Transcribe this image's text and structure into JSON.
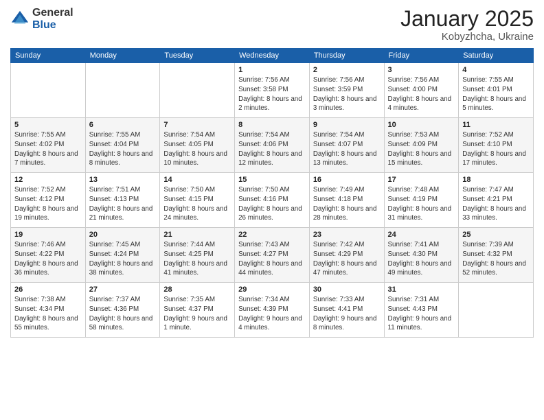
{
  "logo": {
    "general": "General",
    "blue": "Blue"
  },
  "title": {
    "month": "January 2025",
    "location": "Kobyzhcha, Ukraine"
  },
  "days_of_week": [
    "Sunday",
    "Monday",
    "Tuesday",
    "Wednesday",
    "Thursday",
    "Friday",
    "Saturday"
  ],
  "weeks": [
    [
      {
        "day": "",
        "info": ""
      },
      {
        "day": "",
        "info": ""
      },
      {
        "day": "",
        "info": ""
      },
      {
        "day": "1",
        "info": "Sunrise: 7:56 AM\nSunset: 3:58 PM\nDaylight: 8 hours\nand 2 minutes."
      },
      {
        "day": "2",
        "info": "Sunrise: 7:56 AM\nSunset: 3:59 PM\nDaylight: 8 hours\nand 3 minutes."
      },
      {
        "day": "3",
        "info": "Sunrise: 7:56 AM\nSunset: 4:00 PM\nDaylight: 8 hours\nand 4 minutes."
      },
      {
        "day": "4",
        "info": "Sunrise: 7:55 AM\nSunset: 4:01 PM\nDaylight: 8 hours\nand 5 minutes."
      }
    ],
    [
      {
        "day": "5",
        "info": "Sunrise: 7:55 AM\nSunset: 4:02 PM\nDaylight: 8 hours\nand 7 minutes."
      },
      {
        "day": "6",
        "info": "Sunrise: 7:55 AM\nSunset: 4:04 PM\nDaylight: 8 hours\nand 8 minutes."
      },
      {
        "day": "7",
        "info": "Sunrise: 7:54 AM\nSunset: 4:05 PM\nDaylight: 8 hours\nand 10 minutes."
      },
      {
        "day": "8",
        "info": "Sunrise: 7:54 AM\nSunset: 4:06 PM\nDaylight: 8 hours\nand 12 minutes."
      },
      {
        "day": "9",
        "info": "Sunrise: 7:54 AM\nSunset: 4:07 PM\nDaylight: 8 hours\nand 13 minutes."
      },
      {
        "day": "10",
        "info": "Sunrise: 7:53 AM\nSunset: 4:09 PM\nDaylight: 8 hours\nand 15 minutes."
      },
      {
        "day": "11",
        "info": "Sunrise: 7:52 AM\nSunset: 4:10 PM\nDaylight: 8 hours\nand 17 minutes."
      }
    ],
    [
      {
        "day": "12",
        "info": "Sunrise: 7:52 AM\nSunset: 4:12 PM\nDaylight: 8 hours\nand 19 minutes."
      },
      {
        "day": "13",
        "info": "Sunrise: 7:51 AM\nSunset: 4:13 PM\nDaylight: 8 hours\nand 21 minutes."
      },
      {
        "day": "14",
        "info": "Sunrise: 7:50 AM\nSunset: 4:15 PM\nDaylight: 8 hours\nand 24 minutes."
      },
      {
        "day": "15",
        "info": "Sunrise: 7:50 AM\nSunset: 4:16 PM\nDaylight: 8 hours\nand 26 minutes."
      },
      {
        "day": "16",
        "info": "Sunrise: 7:49 AM\nSunset: 4:18 PM\nDaylight: 8 hours\nand 28 minutes."
      },
      {
        "day": "17",
        "info": "Sunrise: 7:48 AM\nSunset: 4:19 PM\nDaylight: 8 hours\nand 31 minutes."
      },
      {
        "day": "18",
        "info": "Sunrise: 7:47 AM\nSunset: 4:21 PM\nDaylight: 8 hours\nand 33 minutes."
      }
    ],
    [
      {
        "day": "19",
        "info": "Sunrise: 7:46 AM\nSunset: 4:22 PM\nDaylight: 8 hours\nand 36 minutes."
      },
      {
        "day": "20",
        "info": "Sunrise: 7:45 AM\nSunset: 4:24 PM\nDaylight: 8 hours\nand 38 minutes."
      },
      {
        "day": "21",
        "info": "Sunrise: 7:44 AM\nSunset: 4:25 PM\nDaylight: 8 hours\nand 41 minutes."
      },
      {
        "day": "22",
        "info": "Sunrise: 7:43 AM\nSunset: 4:27 PM\nDaylight: 8 hours\nand 44 minutes."
      },
      {
        "day": "23",
        "info": "Sunrise: 7:42 AM\nSunset: 4:29 PM\nDaylight: 8 hours\nand 47 minutes."
      },
      {
        "day": "24",
        "info": "Sunrise: 7:41 AM\nSunset: 4:30 PM\nDaylight: 8 hours\nand 49 minutes."
      },
      {
        "day": "25",
        "info": "Sunrise: 7:39 AM\nSunset: 4:32 PM\nDaylight: 8 hours\nand 52 minutes."
      }
    ],
    [
      {
        "day": "26",
        "info": "Sunrise: 7:38 AM\nSunset: 4:34 PM\nDaylight: 8 hours\nand 55 minutes."
      },
      {
        "day": "27",
        "info": "Sunrise: 7:37 AM\nSunset: 4:36 PM\nDaylight: 8 hours\nand 58 minutes."
      },
      {
        "day": "28",
        "info": "Sunrise: 7:35 AM\nSunset: 4:37 PM\nDaylight: 9 hours\nand 1 minute."
      },
      {
        "day": "29",
        "info": "Sunrise: 7:34 AM\nSunset: 4:39 PM\nDaylight: 9 hours\nand 4 minutes."
      },
      {
        "day": "30",
        "info": "Sunrise: 7:33 AM\nSunset: 4:41 PM\nDaylight: 9 hours\nand 8 minutes."
      },
      {
        "day": "31",
        "info": "Sunrise: 7:31 AM\nSunset: 4:43 PM\nDaylight: 9 hours\nand 11 minutes."
      },
      {
        "day": "",
        "info": ""
      }
    ]
  ]
}
